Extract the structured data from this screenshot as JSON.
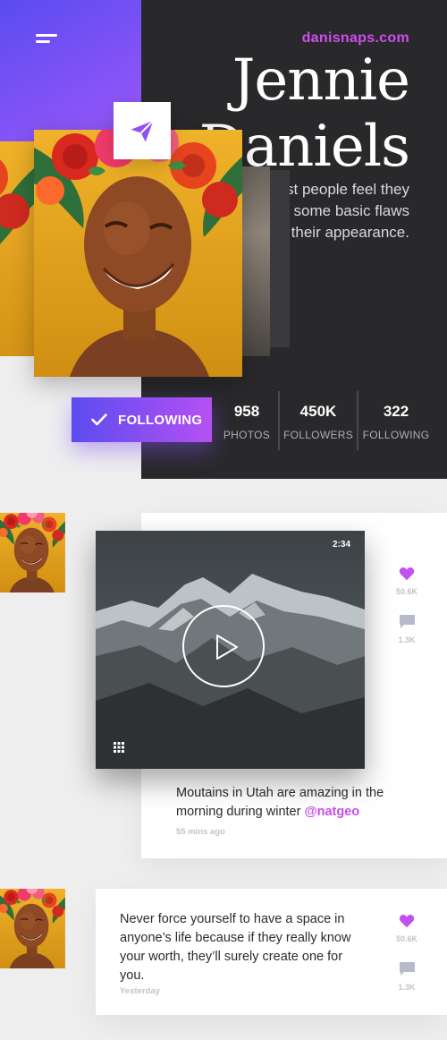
{
  "header": {
    "site": "danisnaps.com",
    "name_first": "Jennie",
    "name_last": "Daniels",
    "tagline": "Most people feel they have some basic flaws with their appearance."
  },
  "follow": {
    "label": "FOLLOWING"
  },
  "stats": [
    {
      "value": "958",
      "label": "PHOTOS"
    },
    {
      "value": "450K",
      "label": "FOLLOWERS"
    },
    {
      "value": "322",
      "label": "FOLLOWING"
    }
  ],
  "posts": [
    {
      "video_duration": "2:34",
      "text": "Moutains in Utah are amazing in the morning during winter",
      "mention": "@natgeo",
      "time": "55 mins ago",
      "likes": "50.6K",
      "comments": "1.3K"
    },
    {
      "text": "Never force yourself to have a space in anyone’s life because if they really know your worth, they’ll surely create one for you.",
      "time": "Yesterday",
      "likes": "50.6K",
      "comments": "1.3K"
    }
  ],
  "colors": {
    "accent": "#c94df0",
    "gradient_start": "#5b4cf0",
    "gradient_end": "#b650f2",
    "dark_panel": "#29292b"
  },
  "icons": [
    "menu-icon",
    "send-icon",
    "check-icon",
    "play-icon",
    "grid-icon",
    "heart-icon",
    "comment-icon"
  ]
}
